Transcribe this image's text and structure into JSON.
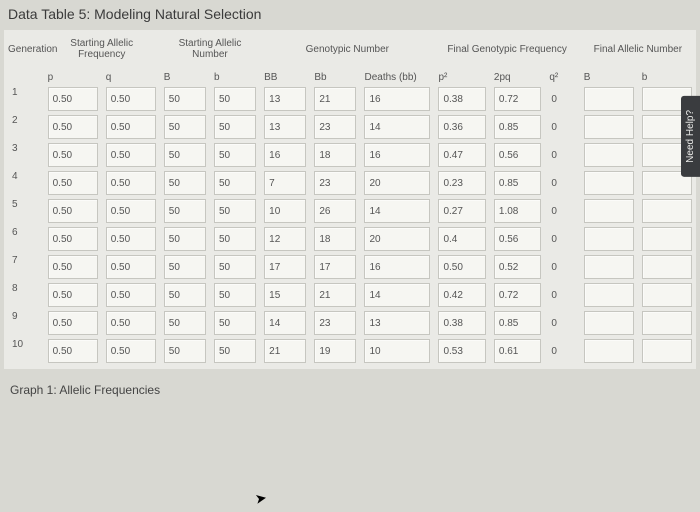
{
  "title": "Data Table 5: Modeling Natural Selection",
  "footer": "Graph 1: Allelic Frequencies",
  "needHelp": "Need Help?",
  "headers": {
    "generation": "Generation",
    "groups": {
      "startFreq": "Starting Allelic Frequency",
      "startNum": "Starting Allelic Number",
      "genoNum": "Genotypic Number",
      "finalFreq": "Final Genotypic Frequency",
      "finalNum": "Final Allelic Number"
    },
    "subs": {
      "p": "p",
      "q": "q",
      "B": "B",
      "b": "b",
      "BB": "BB",
      "Bb": "Bb",
      "deaths": "Deaths (bb)",
      "p2": "p²",
      "twopq": "2pq",
      "q2": "q²",
      "fB": "B",
      "fb": "b"
    }
  },
  "chart_data": {
    "type": "table",
    "columns": [
      "Generation",
      "p",
      "q",
      "B",
      "b",
      "BB",
      "Bb",
      "Deaths (bb)",
      "p2",
      "2pq",
      "q2",
      "Final B",
      "Final b"
    ],
    "rows": [
      {
        "gen": "1",
        "p": "0.50",
        "q": "0.50",
        "B": "50",
        "b": "50",
        "BB": "13",
        "Bb": "21",
        "deaths": "16",
        "p2": "0.38",
        "twopq": "0.72",
        "q2": "0",
        "fB": "",
        "fb": ""
      },
      {
        "gen": "2",
        "p": "0.50",
        "q": "0.50",
        "B": "50",
        "b": "50",
        "BB": "13",
        "Bb": "23",
        "deaths": "14",
        "p2": "0.36",
        "twopq": "0.85",
        "q2": "0",
        "fB": "",
        "fb": ""
      },
      {
        "gen": "3",
        "p": "0.50",
        "q": "0.50",
        "B": "50",
        "b": "50",
        "BB": "16",
        "Bb": "18",
        "deaths": "16",
        "p2": "0.47",
        "twopq": "0.56",
        "q2": "0",
        "fB": "",
        "fb": ""
      },
      {
        "gen": "4",
        "p": "0.50",
        "q": "0.50",
        "B": "50",
        "b": "50",
        "BB": "7",
        "Bb": "23",
        "deaths": "20",
        "p2": "0.23",
        "twopq": "0.85",
        "q2": "0",
        "fB": "",
        "fb": ""
      },
      {
        "gen": "5",
        "p": "0.50",
        "q": "0.50",
        "B": "50",
        "b": "50",
        "BB": "10",
        "Bb": "26",
        "deaths": "14",
        "p2": "0.27",
        "twopq": "1.08",
        "q2": "0",
        "fB": "",
        "fb": ""
      },
      {
        "gen": "6",
        "p": "0.50",
        "q": "0.50",
        "B": "50",
        "b": "50",
        "BB": "12",
        "Bb": "18",
        "deaths": "20",
        "p2": "0.4",
        "twopq": "0.56",
        "q2": "0",
        "fB": "",
        "fb": ""
      },
      {
        "gen": "7",
        "p": "0.50",
        "q": "0.50",
        "B": "50",
        "b": "50",
        "BB": "17",
        "Bb": "17",
        "deaths": "16",
        "p2": "0.50",
        "twopq": "0.52",
        "q2": "0",
        "fB": "",
        "fb": ""
      },
      {
        "gen": "8",
        "p": "0.50",
        "q": "0.50",
        "B": "50",
        "b": "50",
        "BB": "15",
        "Bb": "21",
        "deaths": "14",
        "p2": "0.42",
        "twopq": "0.72",
        "q2": "0",
        "fB": "",
        "fb": ""
      },
      {
        "gen": "9",
        "p": "0.50",
        "q": "0.50",
        "B": "50",
        "b": "50",
        "BB": "14",
        "Bb": "23",
        "deaths": "13",
        "p2": "0.38",
        "twopq": "0.85",
        "q2": "0",
        "fB": "",
        "fb": ""
      },
      {
        "gen": "10",
        "p": "0.50",
        "q": "0.50",
        "B": "50",
        "b": "50",
        "BB": "21",
        "Bb": "19",
        "deaths": "10",
        "p2": "0.53",
        "twopq": "0.61",
        "q2": "0",
        "fB": "",
        "fb": ""
      }
    ]
  }
}
